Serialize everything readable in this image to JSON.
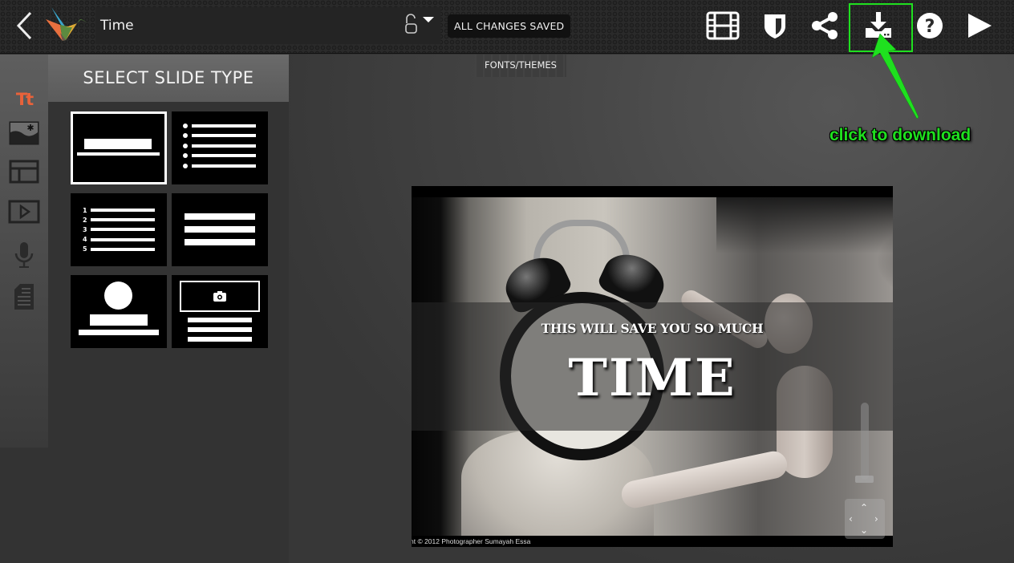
{
  "topbar": {
    "back_icon": "chevron-left-icon",
    "logo": "origami-crane-logo",
    "presentation_title": "Time",
    "lock_icon": "unlock-icon",
    "lock_dropdown_icon": "caret-down-icon",
    "save_status": "ALL CHANGES SAVED",
    "actions": [
      {
        "name": "storyboard",
        "icon": "film-strip-icon"
      },
      {
        "name": "privacy",
        "icon": "shield-icon"
      },
      {
        "name": "share",
        "icon": "share-icon"
      },
      {
        "name": "download",
        "icon": "download-icon"
      },
      {
        "name": "help",
        "icon": "help-circle-icon"
      },
      {
        "name": "play",
        "icon": "play-icon"
      }
    ],
    "highlight_color": "#1fe01f"
  },
  "fonts_themes_tab": "FONTS/THEMES",
  "rail": {
    "items": [
      {
        "name": "text",
        "label": "Tt",
        "icon": "text-icon",
        "active": true
      },
      {
        "name": "image",
        "icon": "image-icon"
      },
      {
        "name": "layout",
        "icon": "layout-icon"
      },
      {
        "name": "video",
        "icon": "video-icon"
      },
      {
        "name": "audio",
        "icon": "microphone-icon"
      },
      {
        "name": "notes",
        "icon": "notes-icon"
      }
    ],
    "active_color": "#e8623a"
  },
  "slide_type_panel": {
    "title": "SELECT SLIDE TYPE",
    "types": [
      {
        "name": "title",
        "selected": true
      },
      {
        "name": "bulleted-list"
      },
      {
        "name": "numbered-list",
        "numbers": [
          "1",
          "2",
          "3",
          "4",
          "5"
        ]
      },
      {
        "name": "text-block"
      },
      {
        "name": "profile"
      },
      {
        "name": "image-caption"
      }
    ]
  },
  "slide": {
    "subtitle": "THIS WILL SAVE YOU SO MUCH",
    "title": "TIME",
    "credit": "nt © 2012 Photographer Sumayah Essa"
  },
  "annotation": {
    "text": "click to download",
    "color": "#1fe01f"
  }
}
